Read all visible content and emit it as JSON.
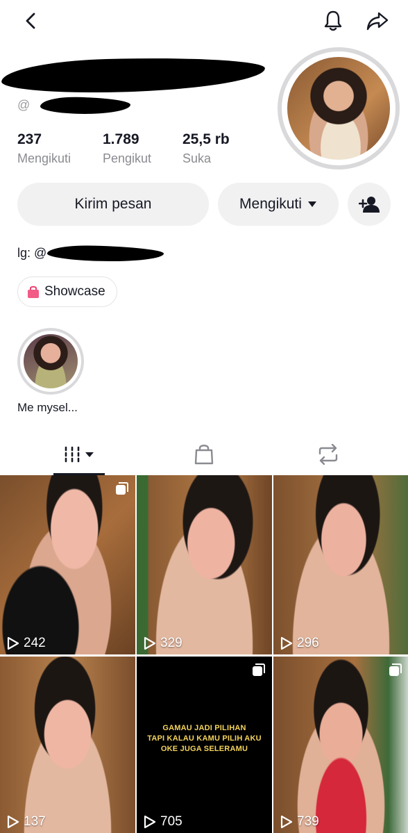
{
  "profile": {
    "handle_prefix": "@",
    "bio_prefix": "lg: @",
    "stats": [
      {
        "value": "237",
        "label": "Mengikuti"
      },
      {
        "value": "1.789",
        "label": "Pengikut"
      },
      {
        "value": "25,5 rb",
        "label": "Suka"
      }
    ]
  },
  "actions": {
    "message_label": "Kirim pesan",
    "following_label": "Mengikuti"
  },
  "showcase": {
    "label": "Showcase"
  },
  "highlight": {
    "label": "Me mysel..."
  },
  "videos": [
    {
      "views": "242",
      "multi": true
    },
    {
      "views": "329",
      "multi": false
    },
    {
      "views": "296",
      "multi": false
    },
    {
      "views": "137",
      "multi": false
    },
    {
      "views": "705",
      "multi": true,
      "text": [
        "GAMAU JADI PILIHAN",
        "TAPI KALAU KAMU PILIH AKU",
        "OKE JUGA SELERAMU"
      ]
    },
    {
      "views": "739",
      "multi": true
    }
  ]
}
